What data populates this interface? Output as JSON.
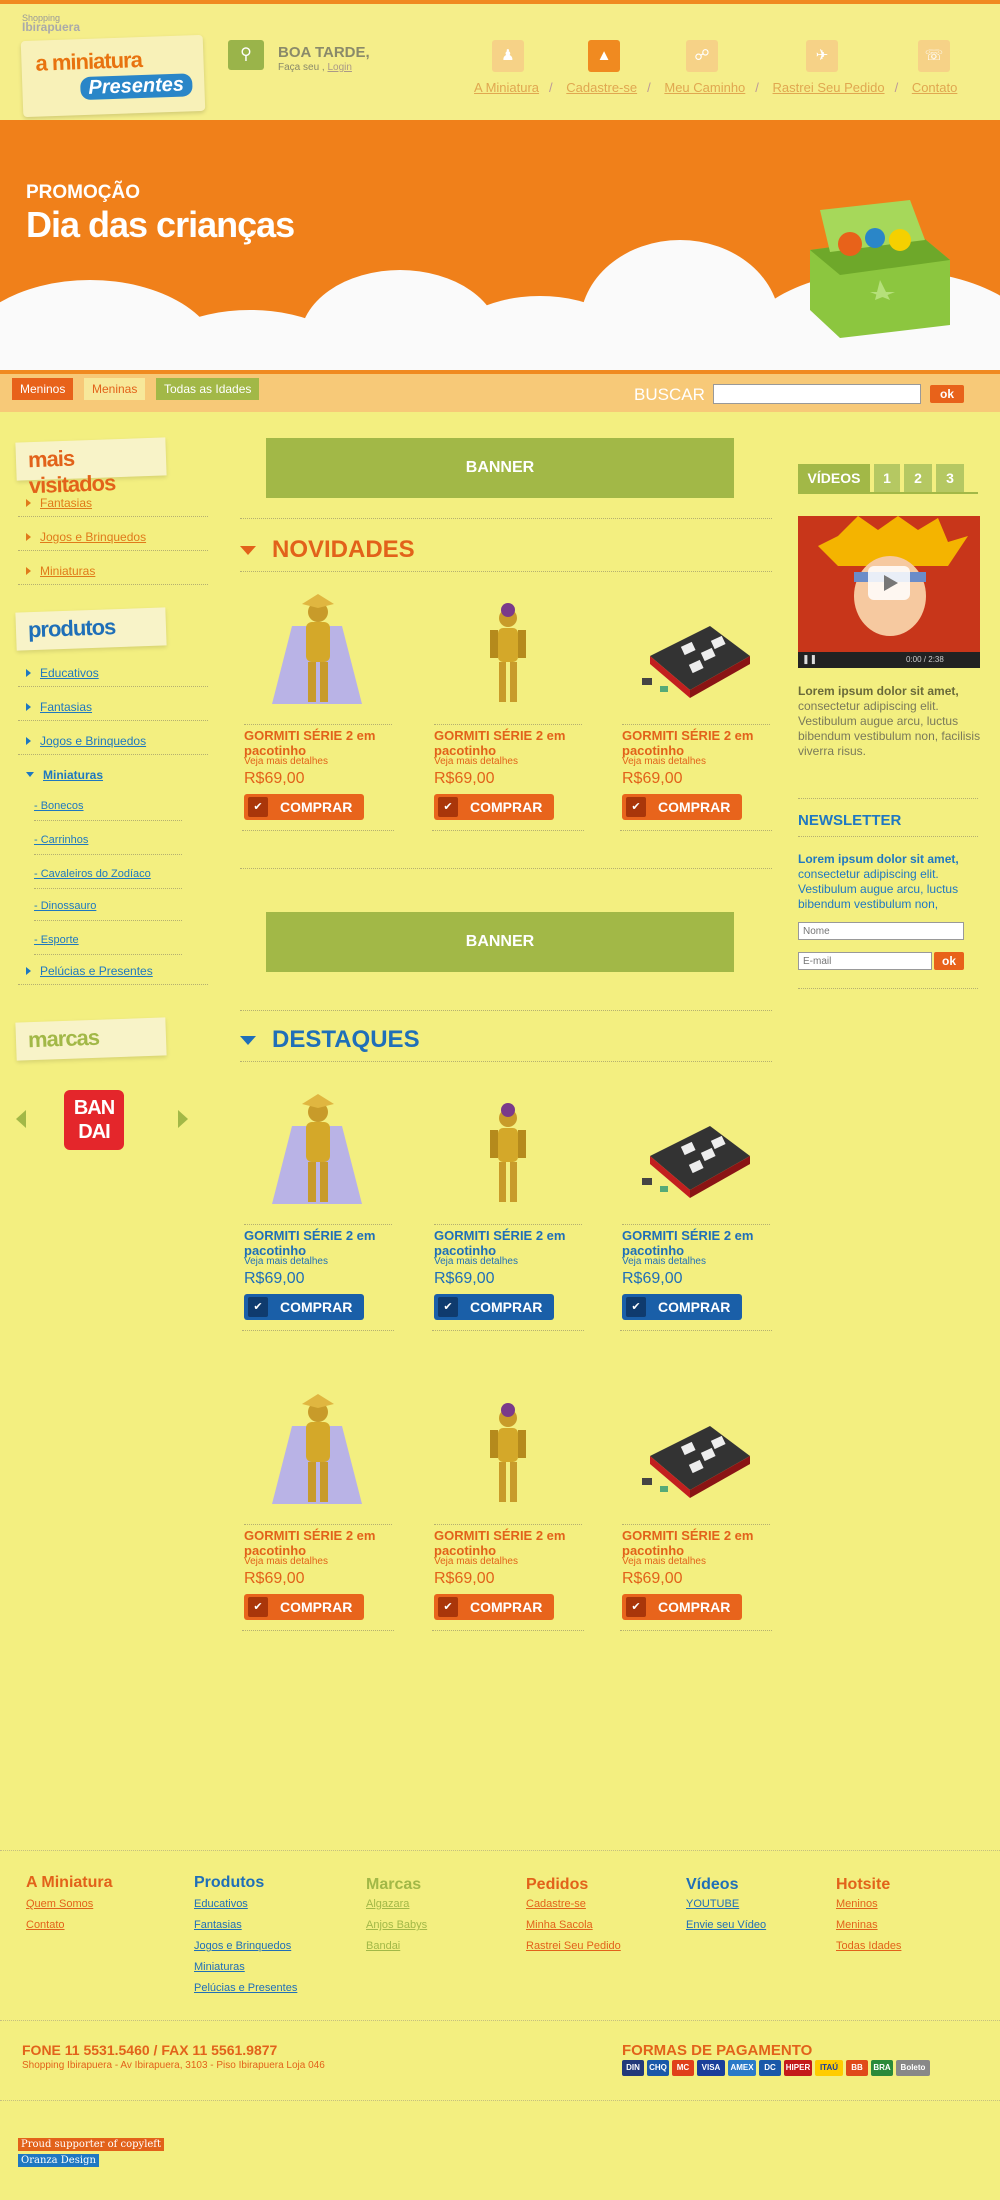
{
  "header": {
    "mall_prefix": "Shopping",
    "mall_name": "Ibirapuera",
    "logo_line1": "a miniatura",
    "logo_line2": "Presentes",
    "greeting": "BOA TARDE,",
    "greeting_sub": "Faça seu ,",
    "login_link": "Login",
    "nav": [
      "A Miniatura",
      "Cadastre-se",
      "Meu Caminho",
      "Rastrei Seu Pedido",
      "Contato"
    ],
    "nav_icons": [
      "people-icon",
      "shirt-icon",
      "cart-icon",
      "plane-icon",
      "phone-icon"
    ],
    "active_nav": 1
  },
  "hero": {
    "promo_small": "PROMOÇÃO",
    "promo_large": "Dia das crianças"
  },
  "category_bar": {
    "tabs": [
      "Meninos",
      "Meninas",
      "Todas as Idades"
    ],
    "tab_colors": [
      "#e8621a",
      "#f7e89a",
      "#a2b847"
    ],
    "search_label": "BUSCAR",
    "search_value": "",
    "ok": "ok"
  },
  "sidebar": {
    "mais_visitados_title": "mais visitados",
    "mais_visitados": [
      "Fantasias",
      "Jogos e Brinquedos",
      "Miniaturas"
    ],
    "produtos_title": "produtos",
    "produtos": [
      "Educativos",
      "Fantasias",
      "Jogos e Brinquedos",
      "Miniaturas"
    ],
    "miniaturas_sub": [
      "- Bonecos",
      "- Carrinhos",
      "- Cavaleiros do Zodíaco",
      "- Dinossauro",
      "- Esporte"
    ],
    "produtos_last": "Pelúcias e Presentes",
    "marcas_title": "marcas",
    "brand_logo": "BAN DAI",
    "brand_line1": "BAN",
    "brand_line2": "DAI"
  },
  "main": {
    "banner_label": "BANNER",
    "novidades_title": "NOVIDADES",
    "destaques_title": "DESTAQUES",
    "product_name": "GORMITI SÉRIE 2 em pacotinho",
    "product_details": "Veja mais detalhes",
    "product_price": "R$69,00",
    "buy_label": "COMPRAR"
  },
  "right": {
    "video_tabs": [
      "VÍDEOS",
      "1",
      "2",
      "3"
    ],
    "video_time": "0:00 / 2:38",
    "video_text_bold": "Lorem ipsum dolor sit amet,",
    "video_text": "consectetur adipiscing elit. Vestibulum augue arcu, luctus bibendum vestibulum non, facilisis viverra risus.",
    "newsletter_title": "NEWSLETTER",
    "newsletter_text_bold": "Lorem ipsum dolor sit amet,",
    "newsletter_text": "consectetur adipiscing elit. Vestibulum augue arcu, luctus bibendum vestibulum non,",
    "nome_placeholder": "Nome",
    "email_placeholder": "E-mail",
    "ok": "ok"
  },
  "footer": {
    "columns": [
      {
        "title": "A Miniatura",
        "color": "#e2621a",
        "links": [
          "Quem Somos",
          "Contato"
        ]
      },
      {
        "title": "Produtos",
        "color": "#1f6fb8",
        "links": [
          "Educativos",
          "Fantasias",
          "Jogos e Brinquedos",
          "Miniaturas",
          "Pelúcias e Presentes"
        ]
      },
      {
        "title": "Marcas",
        "color": "#a2b847",
        "links": [
          "Algazara",
          "Anjos Babys",
          "Bandai"
        ]
      },
      {
        "title": "Pedidos",
        "color": "#e2621a",
        "links": [
          "Cadastre-se",
          "Minha Sacola",
          "Rastrei Seu Pedido"
        ]
      },
      {
        "title": "Vídeos",
        "color": "#1f6fb8",
        "links": [
          "YOUTUBE",
          "Envie seu Vídeo"
        ]
      },
      {
        "title": "Hotsite",
        "color": "#e2621a",
        "links": [
          "Meninos",
          "Meninas",
          "Todas Idades"
        ]
      }
    ],
    "phone": "FONE 11 5531.5460 / FAX 11 5561.9877",
    "address": "Shopping Ibirapuera - Av Ibirapuera, 3103 - Piso Ibirapuera Loja 046",
    "payment_title": "FORMAS DE PAGAMENTO",
    "payment_methods": [
      "DIN",
      "CHQ",
      "MC",
      "VISA",
      "AMEX",
      "DC",
      "HIPER",
      "ITAÚ",
      "BB",
      "BRA",
      "Boleto"
    ],
    "badge1": "Proud supporter of copyleft",
    "badge2": "Oranza Design"
  }
}
